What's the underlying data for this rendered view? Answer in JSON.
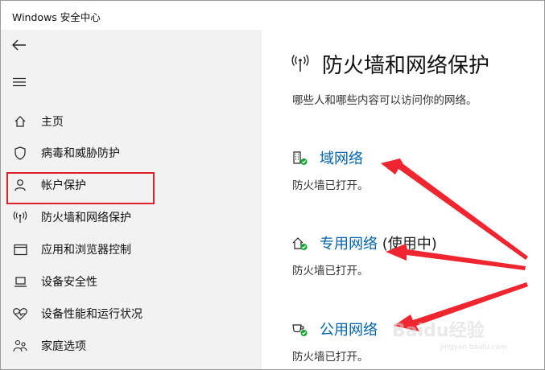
{
  "app": {
    "title": "Windows 安全中心"
  },
  "sidebar": {
    "items": [
      {
        "label": "主页",
        "icon": "home-icon"
      },
      {
        "label": "病毒和威胁防护",
        "icon": "shield-icon"
      },
      {
        "label": "帐户保护",
        "icon": "person-icon"
      },
      {
        "label": "防火墙和网络保护",
        "icon": "antenna-icon"
      },
      {
        "label": "应用和浏览器控制",
        "icon": "app-window-icon"
      },
      {
        "label": "设备安全性",
        "icon": "laptop-icon"
      },
      {
        "label": "设备性能和运行状况",
        "icon": "heart-icon"
      },
      {
        "label": "家庭选项",
        "icon": "family-icon"
      }
    ]
  },
  "main": {
    "title": "防火墙和网络保护",
    "subtitle": "哪些人和哪些内容可以访问你的网络。",
    "networks": [
      {
        "name": "域网络",
        "tag": "",
        "status": "防火墙已打开。",
        "icon": "domain-network-icon"
      },
      {
        "name": "专用网络",
        "tag": " (使用中)",
        "status": "防火墙已打开。",
        "icon": "private-network-icon"
      },
      {
        "name": "公用网络",
        "tag": "",
        "status": "防火墙已打开。",
        "icon": "public-network-icon"
      }
    ]
  },
  "colors": {
    "link": "#0063b1",
    "highlight_box": "#e0202a",
    "arrow": "#ef2630",
    "sidebar_bg": "#f2f2f2",
    "ok_badge": "#10a52c"
  },
  "watermark": {
    "text": "Baidu经验",
    "sub": "jingyan.baidu.com"
  }
}
